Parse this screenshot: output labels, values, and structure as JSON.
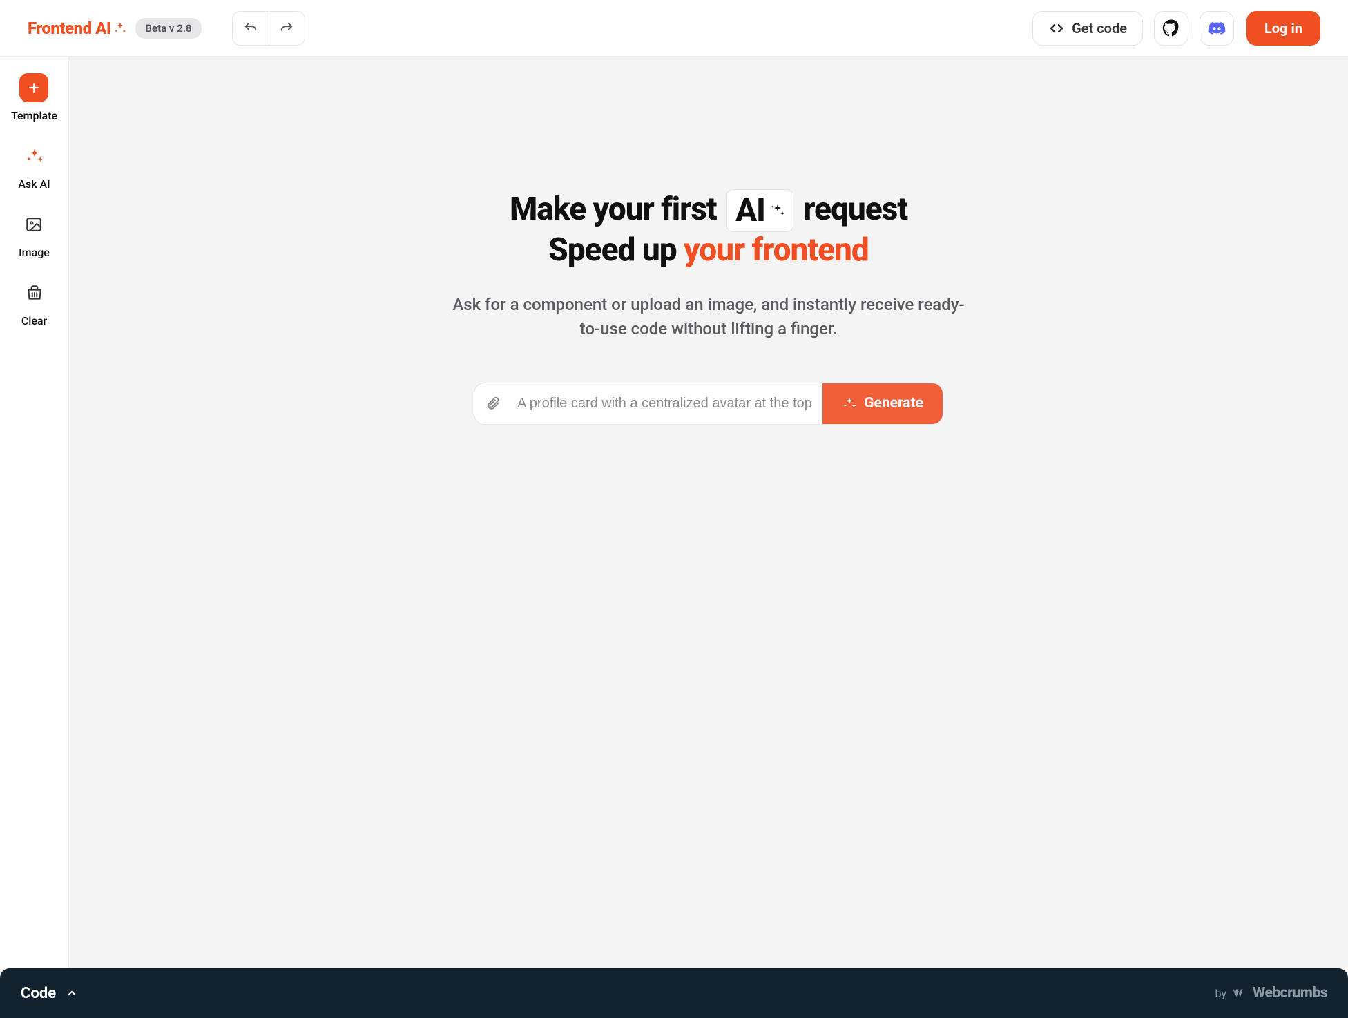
{
  "colors": {
    "accent": "#F04E23",
    "footer_bg": "#11212D"
  },
  "header": {
    "logo_text": "Frontend AI",
    "badge": "Beta v 2.8",
    "get_code": "Get code",
    "login": "Log in"
  },
  "sidebar": [
    {
      "label": "Template"
    },
    {
      "label": "Ask AI"
    },
    {
      "label": "Image"
    },
    {
      "label": "Clear"
    }
  ],
  "hero": {
    "line1_a": "Make your first ",
    "ai_chip": "AI",
    "line1_b": " request",
    "line2_a": "Speed up ",
    "line2_accent": "your frontend"
  },
  "subhero": "Ask for a component or upload an image, and instantly receive ready-to-use code without lifting a finger.",
  "prompt": {
    "placeholder": "A profile card with a centralized avatar at the top",
    "button": "Generate"
  },
  "footer": {
    "code": "Code",
    "by": "by",
    "brand": "Webcrumbs"
  }
}
